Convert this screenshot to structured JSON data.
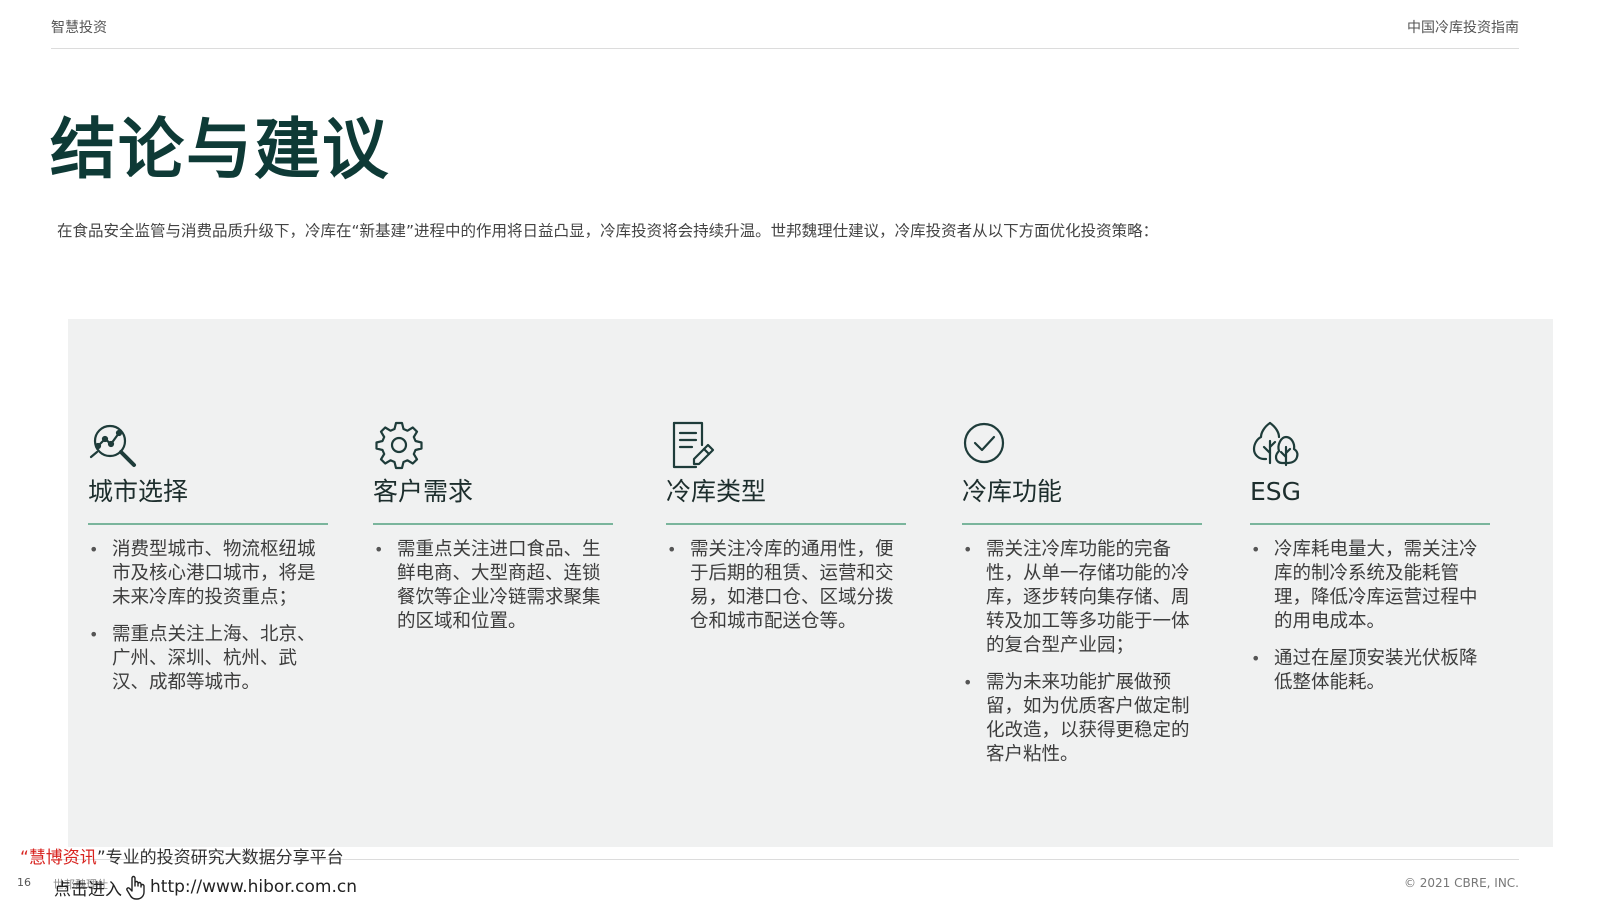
{
  "header": {
    "left": "智慧投资",
    "right": "中国冷库投资指南"
  },
  "title": "结论与建议",
  "intro": "在食品安全监管与消费品质升级下，冷库在“新基建”进程中的作用将日益凸显，冷库投资将会持续升温。世邦魏理仕建议，冷库投资者从以下方面优化投资策略：",
  "columns": [
    {
      "icon": "magnifier-chart-icon",
      "title": "城市选择",
      "bullets": [
        "消费型城市、物流枢纽城市及核心港口城市，将是未来冷库的投资重点；",
        "需重点关注上海、北京、广州、深圳、杭州、武汉、成都等城市。"
      ]
    },
    {
      "icon": "gear-icon",
      "title": "客户需求",
      "bullets": [
        "需重点关注进口食品、生鲜电商、大型商超、连锁餐饮等企业冷链需求聚集的区域和位置。"
      ]
    },
    {
      "icon": "document-edit-icon",
      "title": "冷库类型",
      "bullets": [
        "需关注冷库的通用性，便于后期的租赁、运营和交易，如港口仓、区域分拨仓和城市配送仓等。"
      ]
    },
    {
      "icon": "check-circle-icon",
      "title": "冷库功能",
      "bullets": [
        "需关注冷库功能的完备性，从单一存储功能的冷库，逐步转向集存储、周转及加工等多功能于一体的复合型产业园；",
        "需为未来功能扩展做预留，如为优质客户做定制化改造，以获得更稳定的客户粘性。"
      ]
    },
    {
      "icon": "trees-icon",
      "title": "ESG",
      "bullets": [
        "冷库耗电量大，需关注冷库的制冷系统及能耗管理，降低冷库运营过程中的用电成本。",
        "通过在屋顶安装光伏板降低整体能耗。"
      ]
    }
  ],
  "footer": {
    "page": "16",
    "org": "世邦魏理仕",
    "copyright": "© 2021 CBRE, INC."
  },
  "watermark": {
    "brand": "慧博资讯",
    "quote_open": "“",
    "quote_close": "”",
    "tagline": "专业的投资研究大数据分享平台",
    "enter": "点击进入",
    "url": "http://www.hibor.com.cn"
  }
}
